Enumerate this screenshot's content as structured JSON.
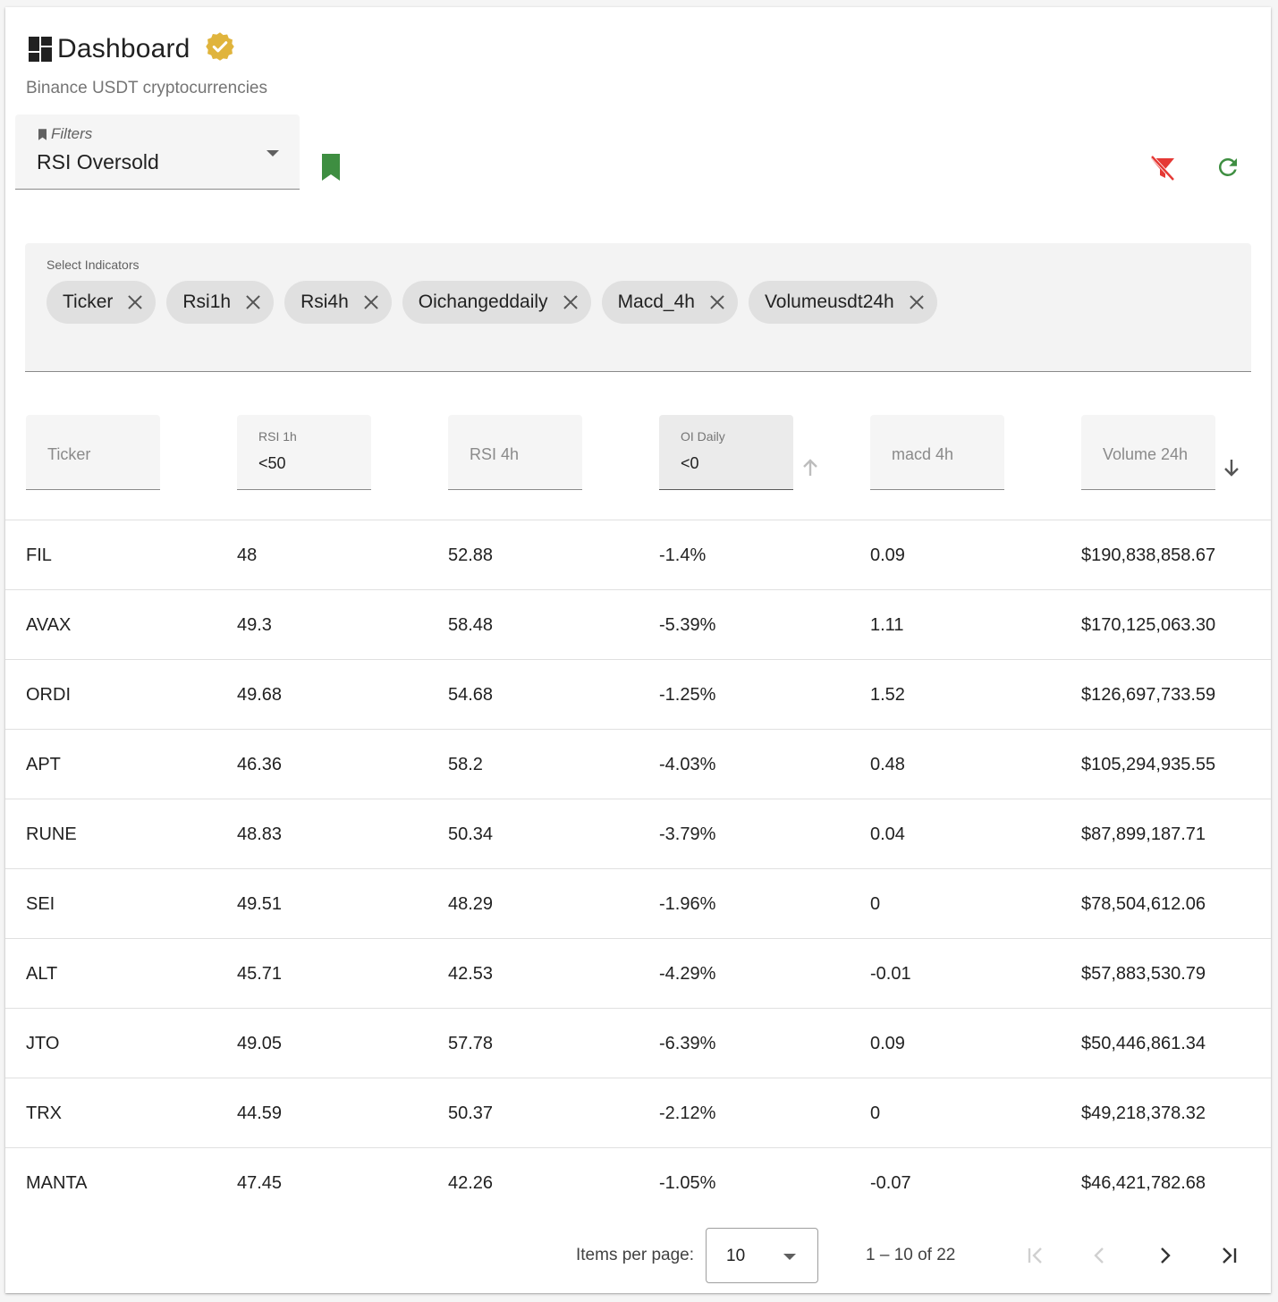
{
  "header": {
    "title": "Dashboard",
    "subtitle": "Binance USDT cryptocurrencies",
    "icon": "dashboard-icon",
    "verified_icon": "verified-badge-icon",
    "verified_color": "#E0B43C"
  },
  "filters": {
    "label": "Filters",
    "value": "RSI Oversold"
  },
  "actions": {
    "bookmark_color": "#3E8E41",
    "clear_filter_color": "#E53935",
    "refresh_color": "#3E8E41"
  },
  "indicators": {
    "label": "Select Indicators",
    "chips": [
      "Ticker",
      "Rsi1h",
      "Rsi4h",
      "Oichangeddaily",
      "Macd_4h",
      "Volumeusdt24h"
    ]
  },
  "table": {
    "columns": [
      {
        "placeholder": "Ticker",
        "label": "",
        "value": ""
      },
      {
        "placeholder": "",
        "label": "RSI 1h",
        "value": "<50"
      },
      {
        "placeholder": "RSI 4h",
        "label": "",
        "value": ""
      },
      {
        "placeholder": "",
        "label": "OI Daily",
        "value": "<0"
      },
      {
        "placeholder": "macd 4h",
        "label": "",
        "value": ""
      },
      {
        "placeholder": "Volume 24h",
        "label": "",
        "value": ""
      }
    ],
    "rows": [
      [
        "FIL",
        "48",
        "52.88",
        "-1.4%",
        "0.09",
        "$190,838,858.67"
      ],
      [
        "AVAX",
        "49.3",
        "58.48",
        "-5.39%",
        "1.11",
        "$170,125,063.30"
      ],
      [
        "ORDI",
        "49.68",
        "54.68",
        "-1.25%",
        "1.52",
        "$126,697,733.59"
      ],
      [
        "APT",
        "46.36",
        "58.2",
        "-4.03%",
        "0.48",
        "$105,294,935.55"
      ],
      [
        "RUNE",
        "48.83",
        "50.34",
        "-3.79%",
        "0.04",
        "$87,899,187.71"
      ],
      [
        "SEI",
        "49.51",
        "48.29",
        "-1.96%",
        "0",
        "$78,504,612.06"
      ],
      [
        "ALT",
        "45.71",
        "42.53",
        "-4.29%",
        "-0.01",
        "$57,883,530.79"
      ],
      [
        "JTO",
        "49.05",
        "57.78",
        "-6.39%",
        "0.09",
        "$50,446,861.34"
      ],
      [
        "TRX",
        "44.59",
        "50.37",
        "-2.12%",
        "0",
        "$49,218,378.32"
      ],
      [
        "MANTA",
        "47.45",
        "42.26",
        "-1.05%",
        "-0.07",
        "$46,421,782.68"
      ]
    ]
  },
  "paginator": {
    "items_per_page_label": "Items per page:",
    "items_per_page": "10",
    "range": "1 – 10 of 22"
  }
}
